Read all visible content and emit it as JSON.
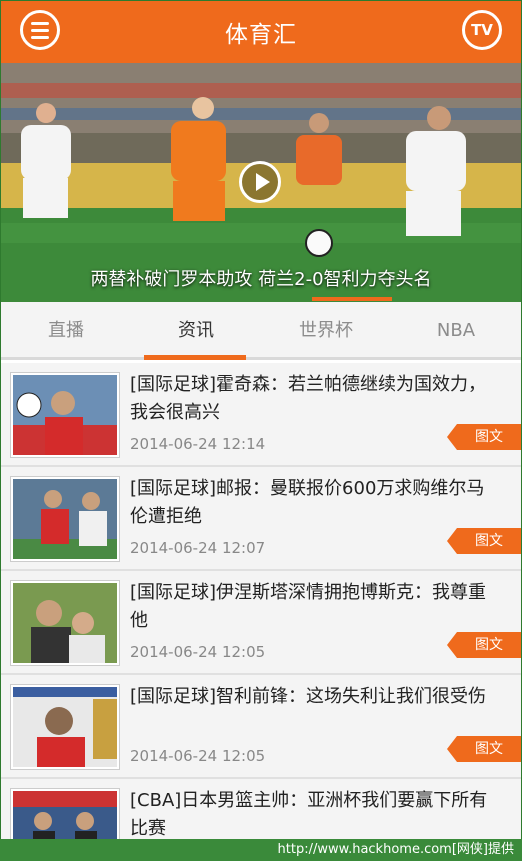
{
  "header": {
    "title": "体育汇",
    "tv_label": "TV"
  },
  "hero": {
    "caption": "两替补破门罗本助攻 荷兰2-0智利力夺头名"
  },
  "tabs": [
    {
      "label": "直播",
      "active": false
    },
    {
      "label": "资讯",
      "active": true
    },
    {
      "label": "世界杯",
      "active": false
    },
    {
      "label": "NBA",
      "active": false
    }
  ],
  "news": [
    {
      "title": "[国际足球]霍奇森：若兰帕德继续为国效力，我会很高兴",
      "time": "2014-06-24 12:14",
      "tag": "图文"
    },
    {
      "title": "[国际足球]邮报：曼联报价600万求购维尔马伦遭拒绝",
      "time": "2014-06-24 12:07",
      "tag": "图文"
    },
    {
      "title": "[国际足球]伊涅斯塔深情拥抱博斯克：我尊重他",
      "time": "2014-06-24 12:05",
      "tag": "图文"
    },
    {
      "title": "[国际足球]智利前锋：这场失利让我们很受伤",
      "time": "2014-06-24 12:05",
      "tag": "图文"
    },
    {
      "title": "[CBA]日本男篮主帅：亚洲杯我们要赢下所有比赛",
      "time": "",
      "tag": ""
    }
  ],
  "watermark": "http://www.hackhome.com[网侠]提供",
  "colors": {
    "accent": "#ef6a1c",
    "watermark_bg": "#3a8a3a"
  }
}
